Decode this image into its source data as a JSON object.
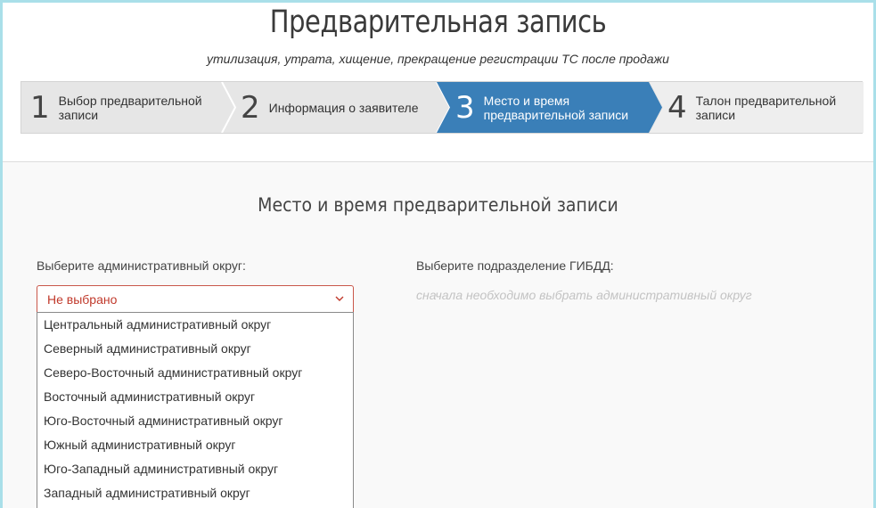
{
  "header": {
    "title": "Предварительная запись",
    "subtitle": "утилизация, утрата, хищение, прекращение регистрации ТС после продажи"
  },
  "steps": [
    {
      "num": "1",
      "label": "Выбор предварительной записи",
      "active": false
    },
    {
      "num": "2",
      "label": "Информация о заявителе",
      "active": false
    },
    {
      "num": "3",
      "label": "Место и время предварительной записи",
      "active": true
    },
    {
      "num": "4",
      "label": "Талон предварительной записи",
      "active": false
    }
  ],
  "colors": {
    "active_step": "#3a7fb8",
    "inactive_step": "#e6e6e6",
    "outer_frame": "#a9dfe9",
    "select_border": "#c9574a",
    "select_text": "#c0392b"
  },
  "main": {
    "section_title": "Место и время предварительной записи",
    "district_label": "Выберите административный округ:",
    "district_selected": "Не выбрано",
    "district_options": [
      "Центральный административный округ",
      "Северный административный округ",
      "Северо-Восточный административный округ",
      "Восточный административный округ",
      "Юго-Восточный административный округ",
      "Южный административный округ",
      "Юго-Западный административный округ",
      "Западный административный округ"
    ],
    "department_label": "Выберите подразделение ГИБДД:",
    "department_hint": "сначала необходимо выбрать административный округ"
  },
  "icons": {
    "select_arrow": "chevron-down-icon"
  }
}
